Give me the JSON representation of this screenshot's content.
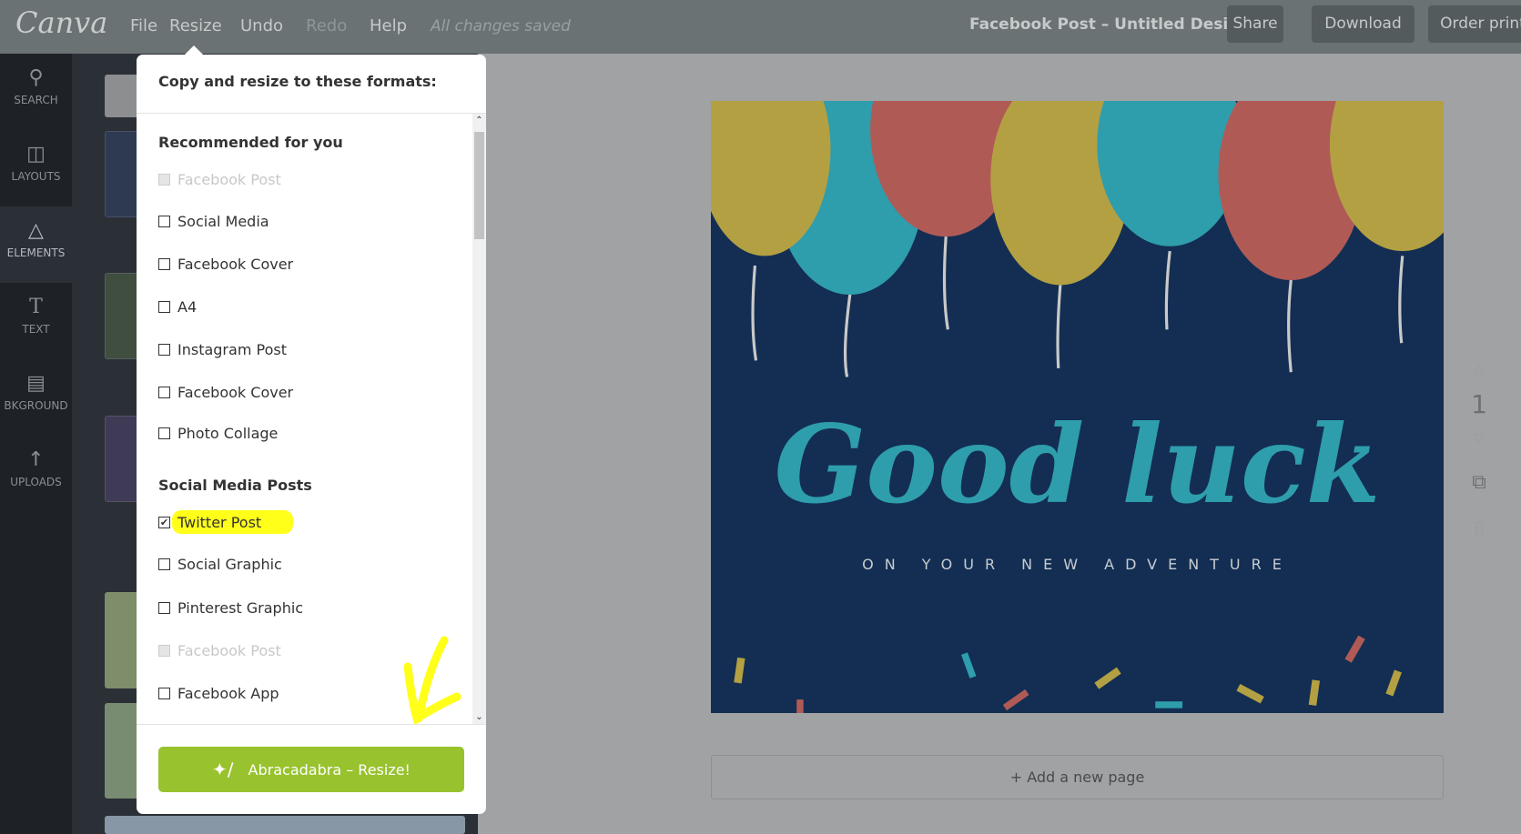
{
  "topbar": {
    "logo": "Canva",
    "menu": [
      "File",
      "Resize",
      "Undo",
      "Redo",
      "Help"
    ],
    "status": "All changes saved",
    "doc_title": "Facebook Post – Untitled Design",
    "buttons": [
      "Share",
      "Download",
      "Order print"
    ]
  },
  "sidebar": {
    "items": [
      {
        "label": "SEARCH",
        "icon": "search-icon"
      },
      {
        "label": "LAYOUTS",
        "icon": "layouts-icon"
      },
      {
        "label": "ELEMENTS",
        "icon": "elements-icon"
      },
      {
        "label": "TEXT",
        "icon": "text-icon"
      },
      {
        "label": "BKGROUND",
        "icon": "background-icon"
      },
      {
        "label": "UPLOADS",
        "icon": "upload-icon"
      }
    ]
  },
  "resize_popup": {
    "title": "Copy and resize to these formats:",
    "sections": [
      {
        "heading": "Recommended for you"
      },
      {
        "heading": "Social Media Posts"
      }
    ],
    "options": [
      {
        "label": "Facebook Post",
        "checked": false,
        "disabled": true
      },
      {
        "label": "Social Media",
        "checked": false,
        "disabled": false
      },
      {
        "label": "Facebook Cover",
        "checked": false,
        "disabled": false
      },
      {
        "label": "A4",
        "checked": false,
        "disabled": false
      },
      {
        "label": "Instagram Post",
        "checked": false,
        "disabled": false
      },
      {
        "label": "Facebook Cover",
        "checked": false,
        "disabled": false
      },
      {
        "label": "Photo Collage",
        "checked": false,
        "disabled": false
      },
      {
        "label": "Twitter Post",
        "checked": true,
        "disabled": false
      },
      {
        "label": "Social Graphic",
        "checked": false,
        "disabled": false
      },
      {
        "label": "Pinterest Graphic",
        "checked": false,
        "disabled": false
      },
      {
        "label": "Facebook Post",
        "checked": false,
        "disabled": true
      },
      {
        "label": "Facebook App",
        "checked": false,
        "disabled": false
      }
    ],
    "button": "Abracadabra – Resize!",
    "accent": "#98c22e",
    "highlight": "#ffff1a"
  },
  "design": {
    "headline": "Good luck",
    "subline": "ON YOUR NEW ADVENTURE",
    "background": "#132e52",
    "colors": {
      "yellow": "#b3a042",
      "teal": "#2e9dac",
      "red": "#b05a56"
    }
  },
  "page_controls": {
    "page_number": "1"
  },
  "add_page": "+ Add a new page"
}
